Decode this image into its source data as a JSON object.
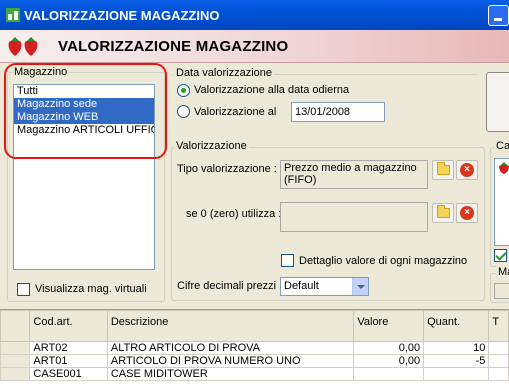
{
  "window": {
    "title": "VALORIZZAZIONE MAGAZZINO"
  },
  "banner": {
    "title": "VALORIZZAZIONE MAGAZZINO"
  },
  "magazzino": {
    "group_label": "Magazzino",
    "items": [
      "Tutti",
      "Magazzino sede",
      "Magazzino WEB",
      "Magazzino ARTICOLI UFFIC"
    ],
    "selected": [
      1,
      2
    ],
    "virtual_label": "Visualizza mag. virtuali"
  },
  "data_val": {
    "group_label": "Data valorizzazione",
    "option_today": "Valorizzazione alla data odierna",
    "option_at": "Valorizzazione al",
    "date_value": "13/01/2008"
  },
  "valorizzazione": {
    "group_label": "Valorizzazione",
    "tipo_label": "Tipo valorizzazione :",
    "tipo_value": "Prezzo medio a magazzino (FIFO)",
    "se_zero_label": "se 0 (zero) utilizza :",
    "se_zero_value": "",
    "dettaglio_label": "Dettaglio valore di ogni magazzino",
    "cifre_label": "Cifre decimali prezzi :",
    "cifre_value": "Default"
  },
  "right_partial": {
    "ca_label": "Ca",
    "ma_label": "Ma"
  },
  "grid": {
    "columns": [
      "",
      "Cod.art.",
      "Descrizione",
      "Valore",
      "Quant.",
      "T"
    ],
    "rows": [
      {
        "cod": "ART02",
        "desc": "ALTRO ARTICOLO DI PROVA",
        "valore": "0,00",
        "quant": "10"
      },
      {
        "cod": "ART01",
        "desc": "ARTICOLO DI PROVA NUMERO UNO",
        "valore": "0,00",
        "quant": "-5"
      },
      {
        "cod": "CASE001",
        "desc": "CASE MIDITOWER",
        "valore": "",
        "quant": ""
      }
    ]
  },
  "colors": {
    "titlebar": "#0054e3",
    "selection": "#316ac5",
    "highlight_circle": "#e81515"
  }
}
